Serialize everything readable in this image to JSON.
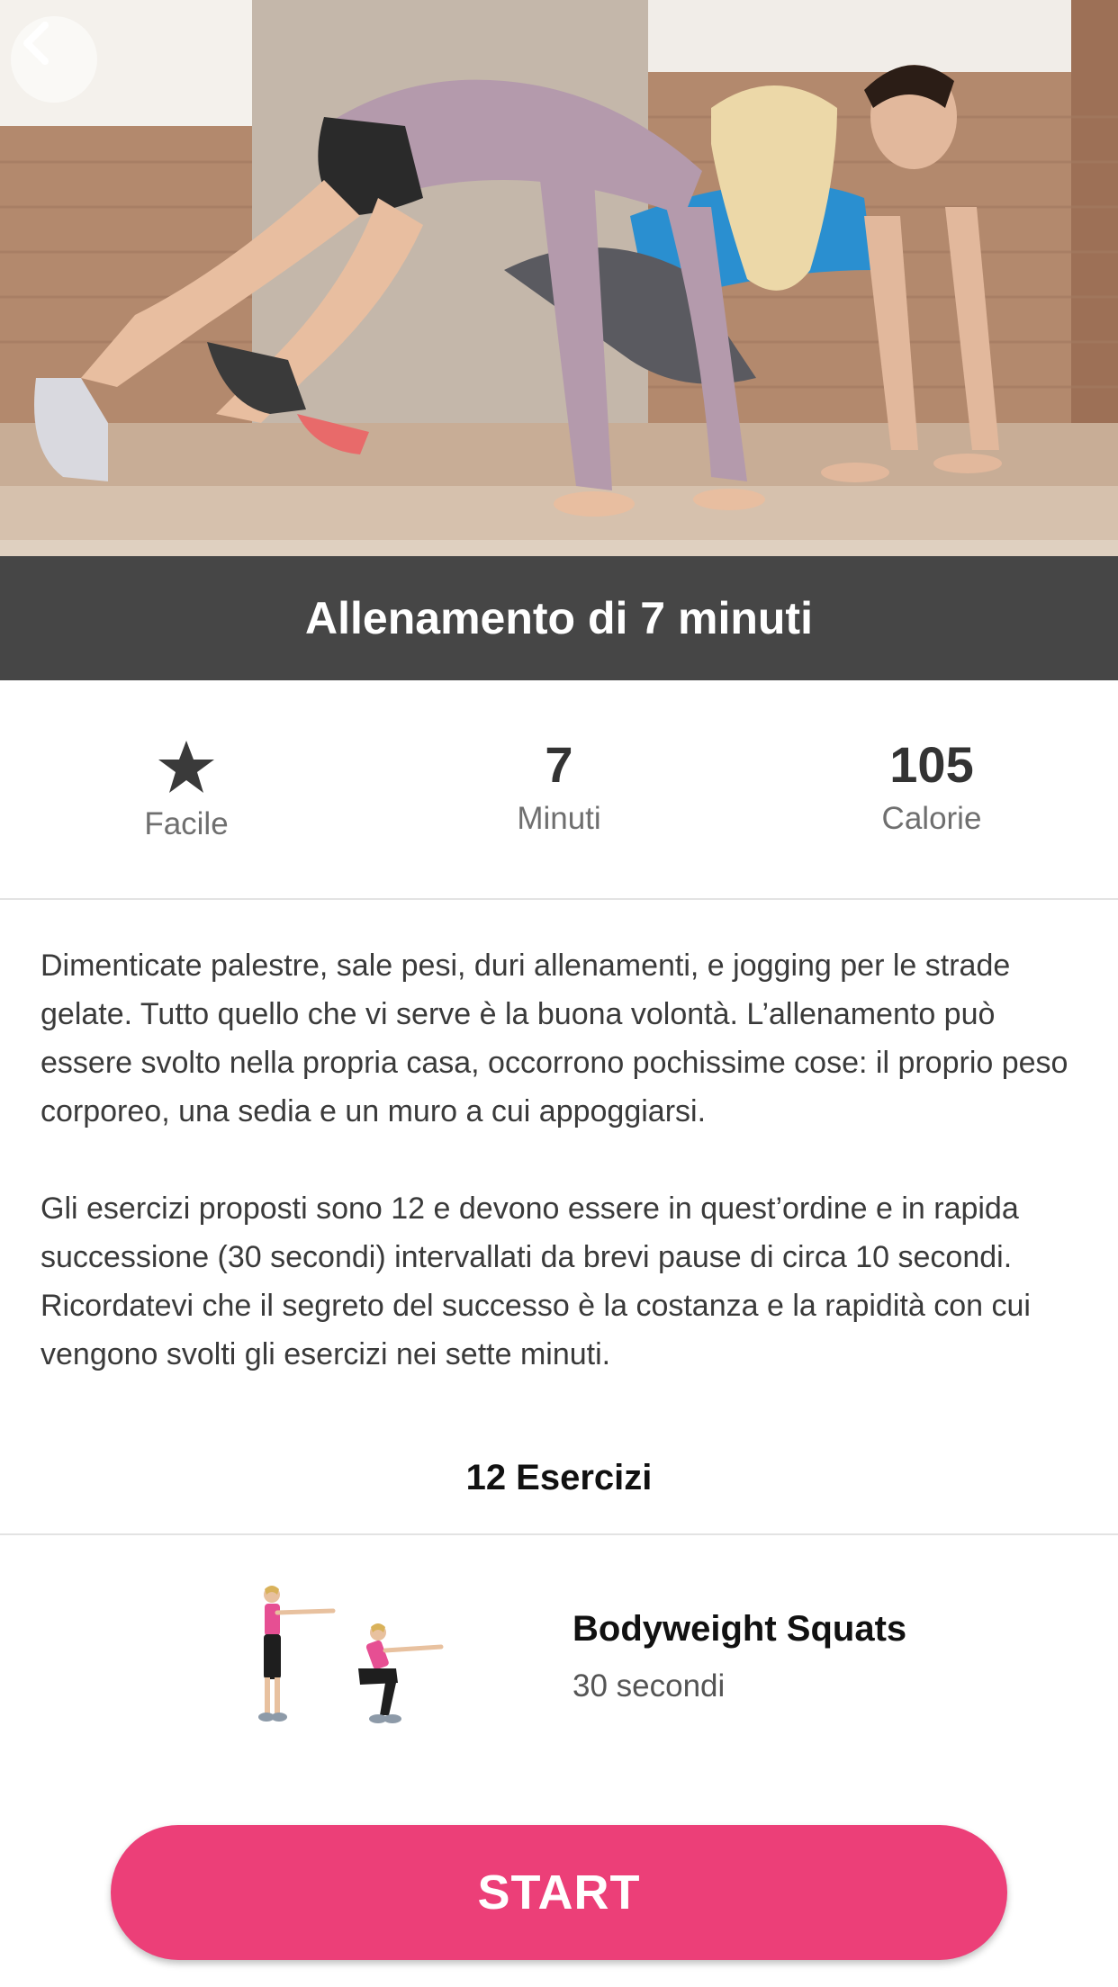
{
  "header": {
    "title": "Allenamento di 7 minuti",
    "back_icon": "back-arrow-icon"
  },
  "stats": {
    "difficulty": {
      "icon": "star-icon",
      "label": "Facile"
    },
    "duration": {
      "value": "7",
      "label": "Minuti"
    },
    "calories": {
      "value": "105",
      "label": "Calorie"
    }
  },
  "description": {
    "paragraph1": "Dimenticate palestre, sale pesi, duri allenamenti, e jogging per le strade gelate. Tutto quello che vi serve è la buona volontà. L’allenamento può essere svolto nella propria casa, occorrono pochissime cose: il proprio peso corporeo, una sedia e un muro a cui appoggiarsi.",
    "paragraph2": "Gli esercizi proposti sono 12 e devono essere in quest’ordine e in rapida successione (30 secondi) intervallati da brevi pause di circa 10 secondi. Ricordatevi che il segreto del successo è la costanza e la rapidità con cui vengono svolti gli esercizi nei sette minuti."
  },
  "exercises": {
    "header": "12 Esercizi",
    "items": [
      {
        "name": "Bodyweight Squats",
        "duration": "30 secondi"
      }
    ]
  },
  "start_button": {
    "label": "START"
  },
  "colors": {
    "accent": "#ec3f78",
    "title_bar": "#464646",
    "text": "#333333"
  }
}
